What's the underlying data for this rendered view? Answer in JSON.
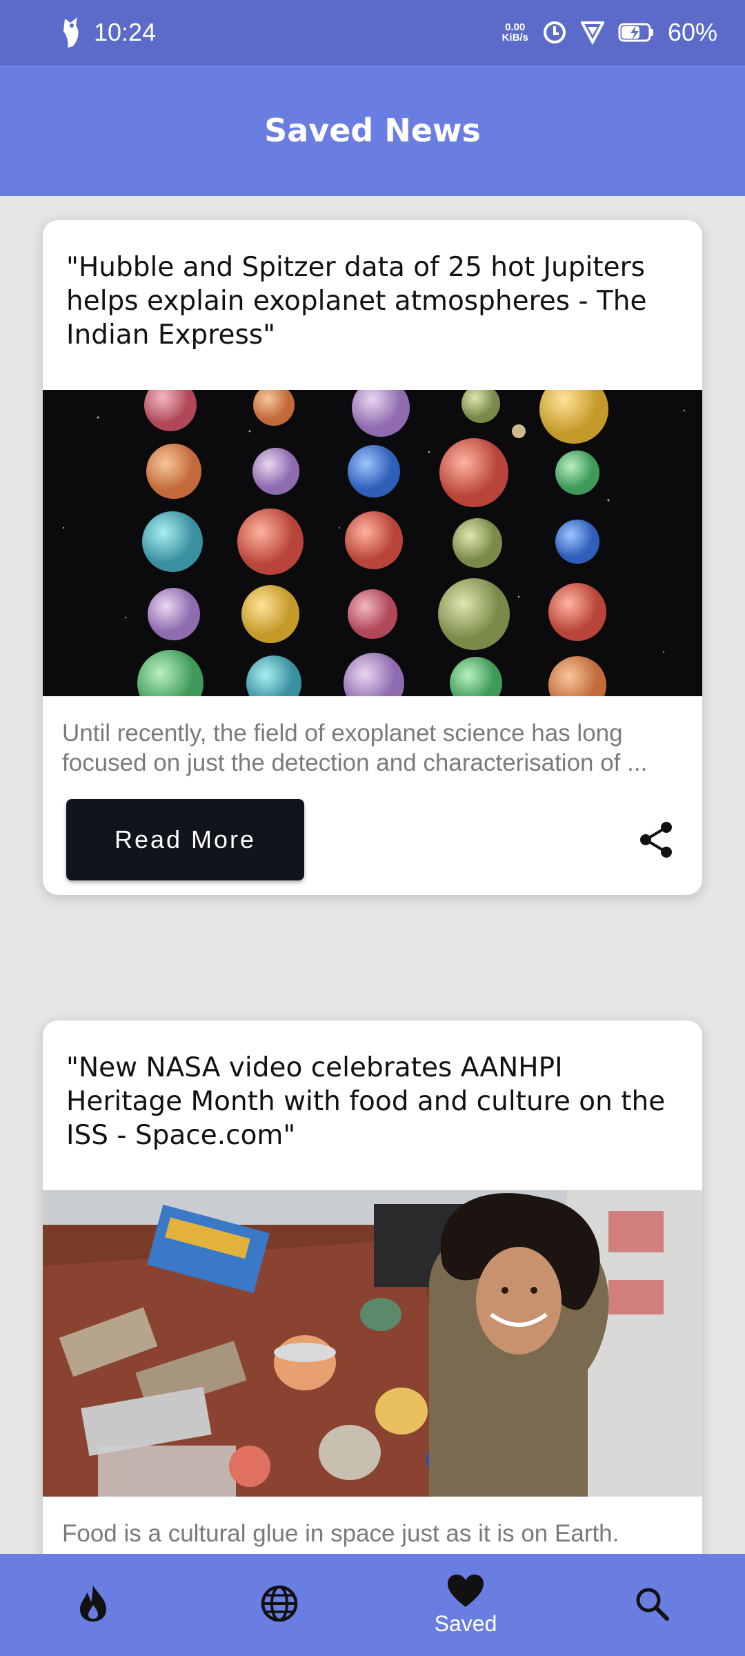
{
  "status_bar": {
    "time": "10:24",
    "net_speed_value": "0.00",
    "net_speed_unit": "KiB/s",
    "battery": "60%"
  },
  "app_bar": {
    "title": "Saved News"
  },
  "articles": [
    {
      "title": "\"Hubble and Spitzer data of 25 hot Jupiters helps explain exoplanet atmospheres - The Indian Express\"",
      "desc_line1": "Until recently, the field of exoplanet science has long",
      "desc_line2": "focused on just the detection and characterisation of ...",
      "read_more": "Read More"
    },
    {
      "title": "\"New NASA video celebrates AANHPI Heritage Month with food and culture on the ISS - Space.com\"",
      "desc_line1": "Food is a cultural glue in space just as it is on Earth."
    }
  ],
  "bottom_nav": {
    "items": [
      {
        "icon": "flame-icon",
        "label": ""
      },
      {
        "icon": "globe-icon",
        "label": ""
      },
      {
        "icon": "heart-icon",
        "label": "Saved"
      },
      {
        "icon": "search-icon",
        "label": ""
      }
    ]
  }
}
